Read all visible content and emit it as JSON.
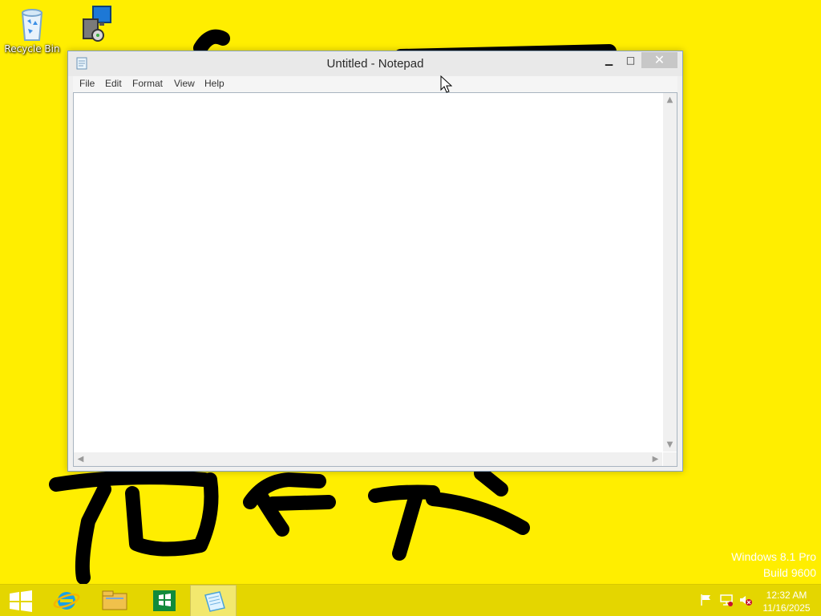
{
  "desktop": {
    "background_color": "#ffee00",
    "icons": [
      {
        "label": "Recycle Bin",
        "icon": "recycle-bin-icon"
      },
      {
        "label": "",
        "icon": "setup-installer-icon"
      }
    ],
    "watermark": {
      "line1": "Windows 8.1 Pro",
      "line2": "Build 9600"
    }
  },
  "window": {
    "title": "Untitled - Notepad",
    "icon": "notepad-icon",
    "controls": {
      "minimize": "minimize-icon",
      "maximize": "maximize-icon",
      "close": "close-icon"
    },
    "menu": [
      {
        "label": "File"
      },
      {
        "label": "Edit"
      },
      {
        "label": "Format"
      },
      {
        "label": "View"
      },
      {
        "label": "Help"
      }
    ],
    "editor": {
      "value": ""
    }
  },
  "taskbar": {
    "color": "#e4d600",
    "apps": [
      {
        "name": "Start",
        "icon": "windows-start-icon"
      },
      {
        "name": "Internet Explorer",
        "icon": "internet-explorer-icon"
      },
      {
        "name": "File Explorer",
        "icon": "file-explorer-icon"
      },
      {
        "name": "Store",
        "icon": "store-icon"
      },
      {
        "name": "Notepad",
        "icon": "notepad-icon",
        "active": true
      }
    ],
    "tray": [
      {
        "icon": "action-center-flag-icon"
      },
      {
        "icon": "network-icon"
      },
      {
        "icon": "volume-muted-icon"
      }
    ],
    "clock": {
      "time": "12:32 AM",
      "date": "11/16/2025"
    }
  }
}
